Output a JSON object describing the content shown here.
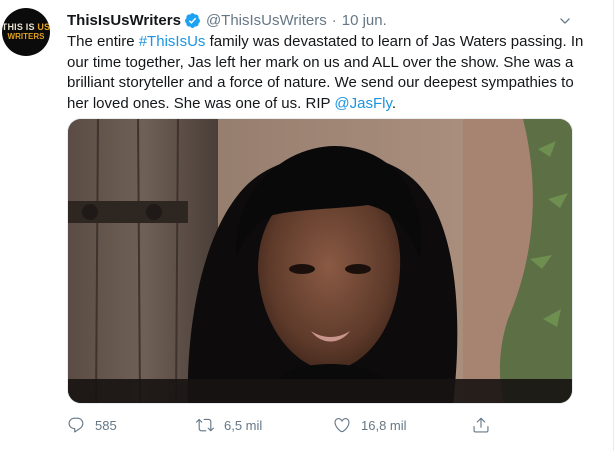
{
  "author": {
    "avatar_logo_top_a": "THIS IS ",
    "avatar_logo_top_b": "US",
    "avatar_logo_bottom": "WRITERS",
    "display_name": "ThisIsUsWriters",
    "handle": "@ThisIsUsWriters",
    "separator": "·",
    "date": "10 jun."
  },
  "tweet": {
    "text_1": "The entire ",
    "hashtag": "#ThisIsUs",
    "text_2": " family was devastated to learn of Jas Waters passing. In our time together, Jas left her mark on us and ALL over the show. She was a brilliant storyteller and a force of nature. We send our deepest sympathies to her loved ones. She was one of us. RIP ",
    "mention": "@JasFly",
    "text_3": "."
  },
  "actions": {
    "reply_count": "585",
    "retweet_count": "6,5 mil",
    "like_count": "16,8 mil"
  },
  "colors": {
    "link": "#1b95e0",
    "verified": "#1da1f2",
    "muted": "#657786",
    "text": "#14171a"
  },
  "icons": {
    "verified": "verified-badge-icon",
    "more": "chevron-down-icon",
    "reply": "reply-icon",
    "retweet": "retweet-icon",
    "like": "heart-icon",
    "share": "share-icon"
  }
}
